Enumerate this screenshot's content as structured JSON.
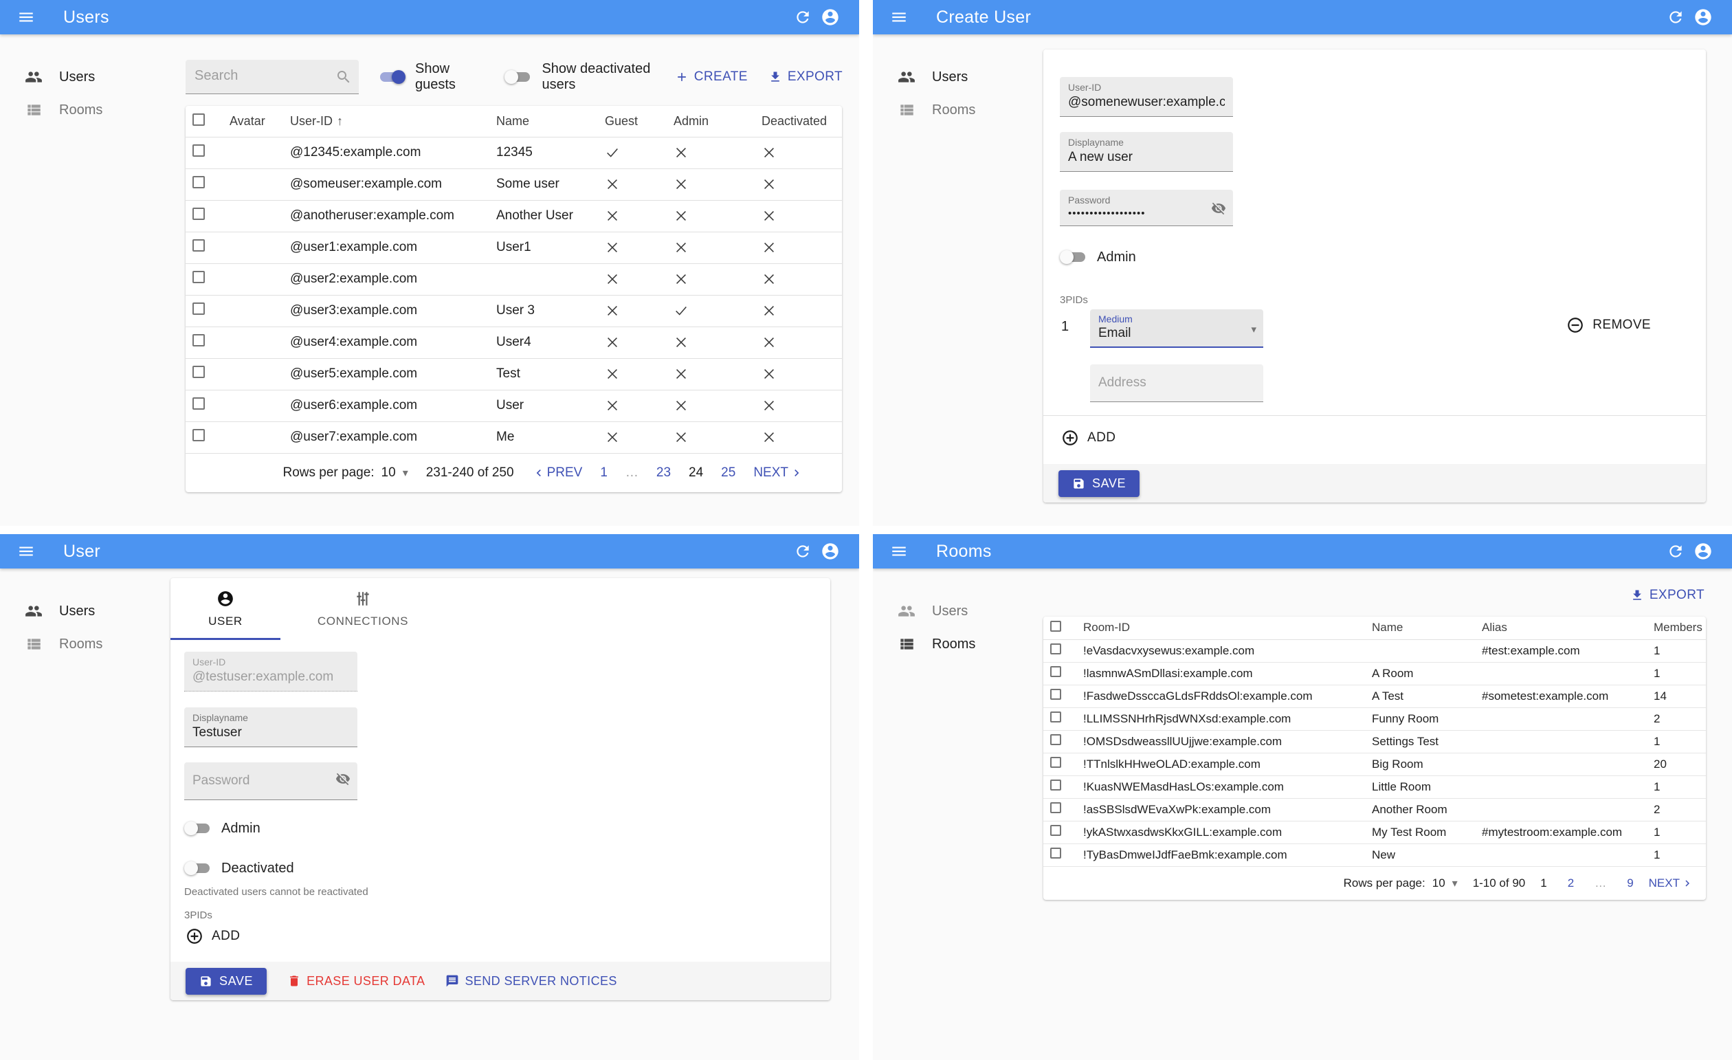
{
  "colors": {
    "appbar_blue": "#4c94f1",
    "accent_indigo": "#3f51b5",
    "danger_red": "#e53935"
  },
  "icons": {
    "check": "✓",
    "cross": "✕",
    "sort_asc": "↑",
    "caret_down": "▾",
    "ellipsis": "…"
  },
  "sidebar": {
    "users": "Users",
    "rooms": "Rooms"
  },
  "users_list": {
    "title": "Users",
    "search_placeholder": "Search",
    "show_guests_label": "Show guests",
    "show_deactivated_label": "Show deactivated users",
    "create_label": "CREATE",
    "export_label": "EXPORT",
    "table": {
      "headers": {
        "avatar": "Avatar",
        "user_id": "User-ID",
        "name": "Name",
        "guest": "Guest",
        "admin": "Admin",
        "deactivated": "Deactivated"
      },
      "rows": [
        {
          "user_id": "@12345:example.com",
          "name": "12345",
          "guest": true,
          "admin": false,
          "deactivated": false
        },
        {
          "user_id": "@someuser:example.com",
          "name": "Some user",
          "guest": false,
          "admin": false,
          "deactivated": false
        },
        {
          "user_id": "@anotheruser:example.com",
          "name": "Another User",
          "guest": false,
          "admin": false,
          "deactivated": false
        },
        {
          "user_id": "@user1:example.com",
          "name": "User1",
          "guest": false,
          "admin": false,
          "deactivated": false
        },
        {
          "user_id": "@user2:example.com",
          "name": "",
          "guest": false,
          "admin": false,
          "deactivated": false
        },
        {
          "user_id": "@user3:example.com",
          "name": "User 3",
          "guest": false,
          "admin": true,
          "deactivated": false
        },
        {
          "user_id": "@user4:example.com",
          "name": "User4",
          "guest": false,
          "admin": false,
          "deactivated": false
        },
        {
          "user_id": "@user5:example.com",
          "name": "Test",
          "guest": false,
          "admin": false,
          "deactivated": false
        },
        {
          "user_id": "@user6:example.com",
          "name": "User",
          "guest": false,
          "admin": false,
          "deactivated": false
        },
        {
          "user_id": "@user7:example.com",
          "name": "Me",
          "guest": false,
          "admin": false,
          "deactivated": false
        }
      ]
    },
    "pagination": {
      "rows_per_page_label": "Rows per page:",
      "rows_per_page": "10",
      "range": "231-240 of 250",
      "prev_label": "PREV",
      "next_label": "NEXT",
      "pages": [
        {
          "label": "1",
          "state": "link"
        },
        {
          "label": "…",
          "state": "ellipsis"
        },
        {
          "label": "23",
          "state": "link"
        },
        {
          "label": "24",
          "state": "current"
        },
        {
          "label": "25",
          "state": "link"
        }
      ]
    }
  },
  "create_user": {
    "title": "Create User",
    "user_id": {
      "label": "User-ID",
      "value": "@somenewuser:example.com"
    },
    "displayname": {
      "label": "Displayname",
      "value": "A new user"
    },
    "password": {
      "label": "Password",
      "value": "••••••••••••••••••"
    },
    "admin_label": "Admin",
    "threepids_label": "3PIDs",
    "threepid": {
      "index": "1",
      "medium_label": "Medium",
      "medium_value": "Email",
      "address_placeholder": "Address"
    },
    "remove_label": "REMOVE",
    "add_label": "ADD",
    "save_label": "SAVE"
  },
  "user_edit": {
    "title": "User",
    "tabs": {
      "user": "USER",
      "connections": "CONNECTIONS"
    },
    "user_id": {
      "label": "User-ID",
      "value": "@testuser:example.com"
    },
    "displayname": {
      "label": "Displayname",
      "value": "Testuser"
    },
    "password_placeholder": "Password",
    "admin_label": "Admin",
    "deactivated_label": "Deactivated",
    "deactivated_helper": "Deactivated users cannot be reactivated",
    "threepids_label": "3PIDs",
    "add_label": "ADD",
    "save_label": "SAVE",
    "erase_label": "ERASE USER DATA",
    "notices_label": "SEND SERVER NOTICES"
  },
  "rooms": {
    "title": "Rooms",
    "export_label": "EXPORT",
    "table": {
      "headers": {
        "room_id": "Room-ID",
        "name": "Name",
        "alias": "Alias",
        "members": "Members"
      },
      "rows": [
        {
          "room_id": "!eVasdacvxysewus:example.com",
          "name": "",
          "alias": "#test:example.com",
          "members": "1"
        },
        {
          "room_id": "!lasmnwASmDllasi:example.com",
          "name": "A Room",
          "alias": "",
          "members": "1"
        },
        {
          "room_id": "!FasdweDssccaGLdsFRddsOl:example.com",
          "name": "A Test",
          "alias": "#sometest:example.com",
          "members": "14"
        },
        {
          "room_id": "!LLIMSSNHrhRjsdWNXsd:example.com",
          "name": "Funny Room",
          "alias": "",
          "members": "2"
        },
        {
          "room_id": "!OMSDsdweassllUUjjwe:example.com",
          "name": "Settings Test",
          "alias": "",
          "members": "1"
        },
        {
          "room_id": "!TTnlslkHHweOLAD:example.com",
          "name": "Big Room",
          "alias": "",
          "members": "20"
        },
        {
          "room_id": "!KuasNWEMasdHasLOs:example.com",
          "name": "Little Room",
          "alias": "",
          "members": "1"
        },
        {
          "room_id": "!asSBSlsdWEvaXwPk:example.com",
          "name": "Another Room",
          "alias": "",
          "members": "2"
        },
        {
          "room_id": "!ykAStwxasdwsKkxGILL:example.com",
          "name": "My Test Room",
          "alias": "#mytestroom:example.com",
          "members": "1"
        },
        {
          "room_id": "!TyBasDmweIJdfFaeBmk:example.com",
          "name": "New",
          "alias": "",
          "members": "1"
        }
      ]
    },
    "pagination": {
      "rows_per_page_label": "Rows per page:",
      "rows_per_page": "10",
      "range": "1-10 of 90",
      "next_label": "NEXT",
      "pages": [
        {
          "label": "1",
          "state": "current"
        },
        {
          "label": "2",
          "state": "link"
        },
        {
          "label": "…",
          "state": "ellipsis"
        },
        {
          "label": "9",
          "state": "link"
        }
      ]
    }
  }
}
